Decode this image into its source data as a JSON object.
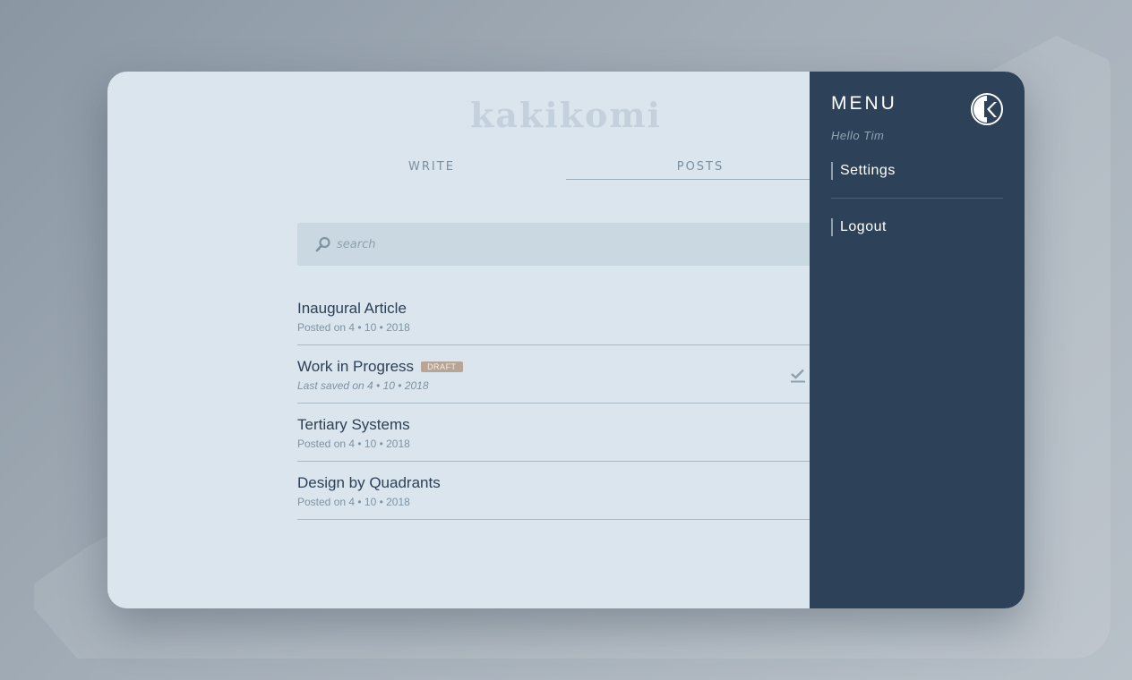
{
  "app": {
    "logo": "kakikomi",
    "tabs": [
      {
        "label": "WRITE"
      },
      {
        "label": "POSTS"
      }
    ],
    "search": {
      "placeholder": "search"
    },
    "posts": [
      {
        "title": "Inaugural Article",
        "date": "Posted on 4 • 10 • 2018"
      },
      {
        "title": "Work in Progress",
        "badge": "DRAFT",
        "date": "Last saved on 4 • 10 • 2018"
      },
      {
        "title": "Tertiary Systems",
        "date": "Posted on 4 • 10 • 2018"
      },
      {
        "title": "Design by Quadrants",
        "date": "Posted on 4 • 10 • 2018"
      }
    ]
  },
  "menu": {
    "title": "MENU",
    "greeting": "Hello Tim",
    "items": [
      {
        "label": "Settings"
      },
      {
        "label": "Logout"
      }
    ]
  },
  "icons": {
    "search": "search-icon",
    "edit": "pencil-icon",
    "publish": "check-icon",
    "logo": "kakikomi-logo-icon"
  },
  "colors": {
    "accent": "#2d4259",
    "background": "#dae5ee",
    "draft_badge": "#b9a596"
  }
}
